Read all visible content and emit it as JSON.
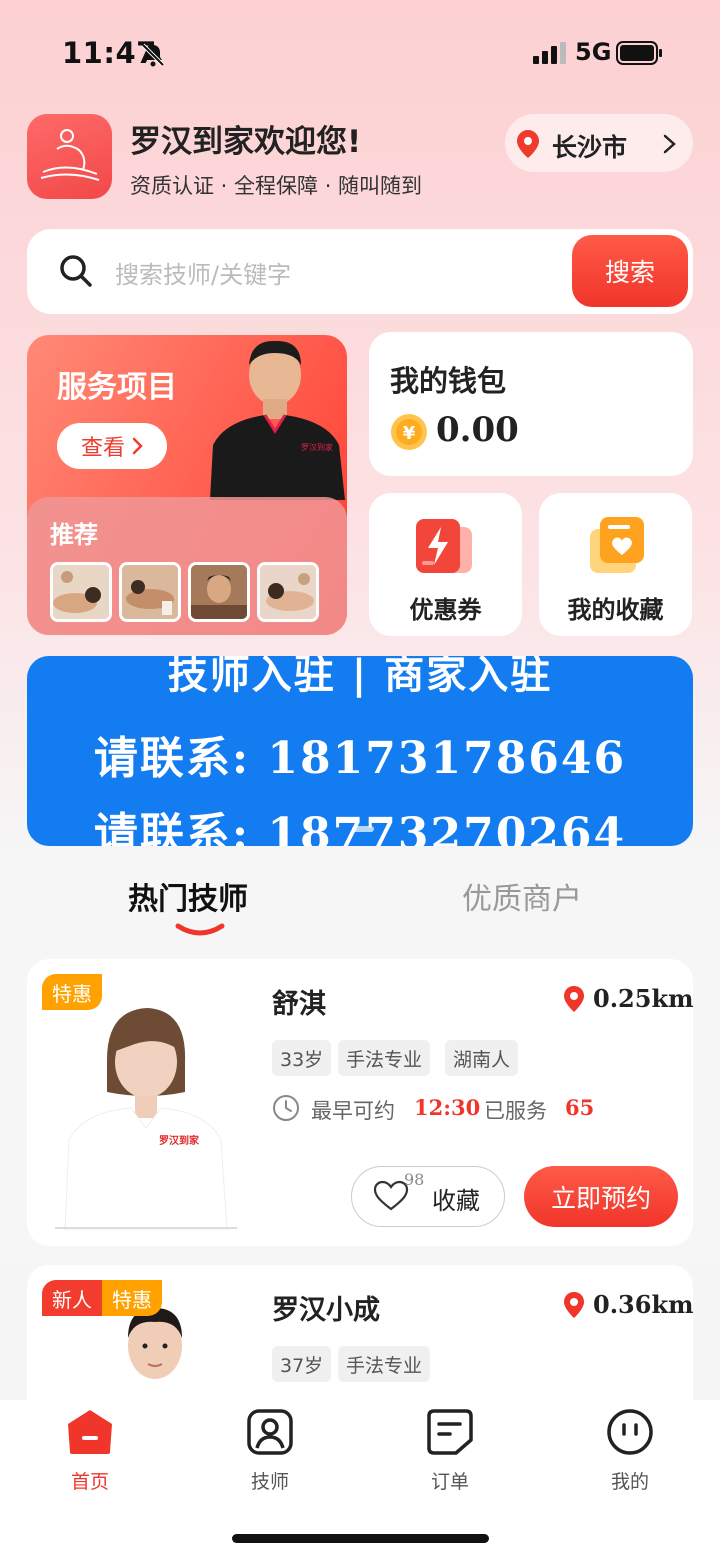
{
  "status": {
    "time": "11:47",
    "network": "5G"
  },
  "header": {
    "title": "罗汉到家欢迎您!",
    "subtitle": "资质认证 · 全程保障 · 随叫随到",
    "city": "长沙市"
  },
  "search": {
    "placeholder": "搜索技师/关键字",
    "button": "搜索"
  },
  "service": {
    "title": "服务项目",
    "view": "查看",
    "recommend": "推荐"
  },
  "wallet": {
    "title": "我的钱包",
    "balance": "0.00"
  },
  "quick": {
    "coupon": "优惠券",
    "favorites": "我的收藏"
  },
  "banner": {
    "line1": "技师入驻 | 商家入驻",
    "line2": "请联系: 18173178646",
    "line3": "请联系: 18773270264"
  },
  "tabs": {
    "active": "热门技师",
    "inactive": "优质商户"
  },
  "therapists": [
    {
      "badges": [
        "特惠"
      ],
      "name": "舒淇",
      "distance": "0.25km",
      "tags": [
        "33岁",
        "手法专业",
        "湖南人"
      ],
      "earliest_label": "最早可约",
      "earliest_time": "12:30",
      "served_label": "已服务",
      "served_count": "65",
      "fav_count": "98",
      "fav_label": "收藏",
      "book_label": "立即预约",
      "shirt_text": "罗汉到家"
    },
    {
      "badges": [
        "新人",
        "特惠"
      ],
      "name": "罗汉小成",
      "distance": "0.36km",
      "tags": [
        "37岁",
        "手法专业"
      ]
    }
  ],
  "model_shirt_text": "罗汉到家",
  "nav": {
    "home": "首页",
    "technician": "技师",
    "orders": "订单",
    "mine": "我的"
  },
  "colors": {
    "accent": "#f0352b",
    "badge_sale": "#ffa200",
    "banner": "#127cf0"
  }
}
